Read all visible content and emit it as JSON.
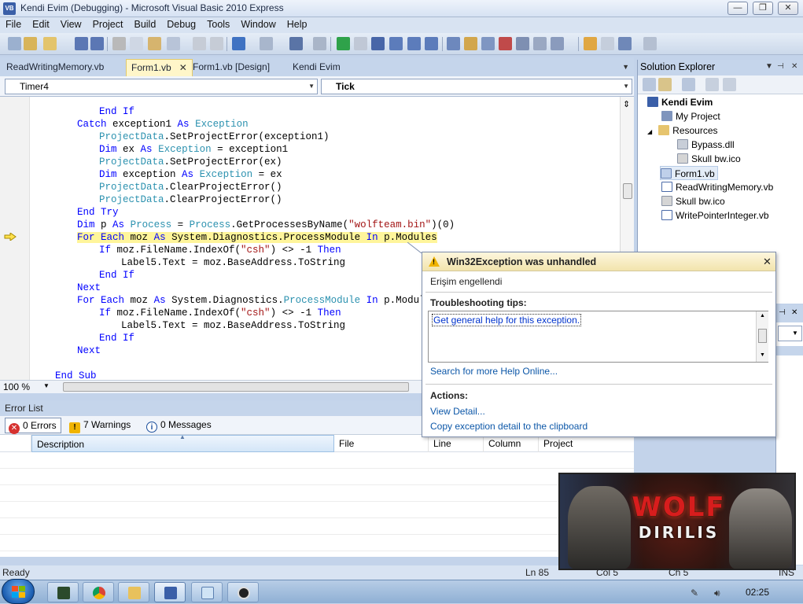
{
  "window": {
    "title": "Kendi Evim (Debugging) - Microsoft Visual Basic 2010 Express",
    "app_icon": "VB",
    "minimize": "—",
    "restore": "❐",
    "close": "✕"
  },
  "menu": [
    "File",
    "Edit",
    "View",
    "Project",
    "Build",
    "Debug",
    "Tools",
    "Window",
    "Help"
  ],
  "tabs": {
    "items": [
      {
        "label": "ReadWritingMemory.vb",
        "active": false
      },
      {
        "label": "Form1.vb",
        "active": true,
        "close": "✕"
      },
      {
        "label": "Form1.vb [Design]",
        "active": false
      },
      {
        "label": "Kendi Evim",
        "active": false
      }
    ],
    "overflow": "▼"
  },
  "combos": {
    "object": "Timer4",
    "event": "Tick"
  },
  "code_lines": [
    {
      "indent": 12,
      "tokens": [
        {
          "t": "End If",
          "c": "kw"
        }
      ]
    },
    {
      "indent": 8,
      "tokens": [
        {
          "t": "Catch",
          "c": "kw"
        },
        {
          "t": " exception1 "
        },
        {
          "t": "As",
          "c": "kw"
        },
        {
          "t": " "
        },
        {
          "t": "Exception",
          "c": "ty"
        }
      ]
    },
    {
      "indent": 12,
      "tokens": [
        {
          "t": "ProjectData",
          "c": "ty"
        },
        {
          "t": ".SetProjectError(exception1)"
        }
      ]
    },
    {
      "indent": 12,
      "tokens": [
        {
          "t": "Dim",
          "c": "kw"
        },
        {
          "t": " ex "
        },
        {
          "t": "As",
          "c": "kw"
        },
        {
          "t": " "
        },
        {
          "t": "Exception",
          "c": "ty"
        },
        {
          "t": " = exception1"
        }
      ]
    },
    {
      "indent": 12,
      "tokens": [
        {
          "t": "ProjectData",
          "c": "ty"
        },
        {
          "t": ".SetProjectError(ex)"
        }
      ]
    },
    {
      "indent": 12,
      "tokens": [
        {
          "t": "Dim",
          "c": "kw"
        },
        {
          "t": " exception "
        },
        {
          "t": "As",
          "c": "kw"
        },
        {
          "t": " "
        },
        {
          "t": "Exception",
          "c": "ty"
        },
        {
          "t": " = ex"
        }
      ]
    },
    {
      "indent": 12,
      "tokens": [
        {
          "t": "ProjectData",
          "c": "ty"
        },
        {
          "t": ".ClearProjectError()"
        }
      ]
    },
    {
      "indent": 12,
      "tokens": [
        {
          "t": "ProjectData",
          "c": "ty"
        },
        {
          "t": ".ClearProjectError()"
        }
      ]
    },
    {
      "indent": 8,
      "tokens": [
        {
          "t": "End Try",
          "c": "kw"
        }
      ]
    },
    {
      "indent": 8,
      "tokens": [
        {
          "t": "Dim",
          "c": "kw"
        },
        {
          "t": " p "
        },
        {
          "t": "As",
          "c": "kw"
        },
        {
          "t": " "
        },
        {
          "t": "Process",
          "c": "ty"
        },
        {
          "t": " = "
        },
        {
          "t": "Process",
          "c": "ty"
        },
        {
          "t": ".GetProcessesByName("
        },
        {
          "t": "\"wolfteam.bin\"",
          "c": "st"
        },
        {
          "t": ")(0)"
        }
      ]
    },
    {
      "indent": 8,
      "highlight": true,
      "tokens": [
        {
          "t": "For",
          "c": "kw"
        },
        {
          "t": " "
        },
        {
          "t": "Each",
          "c": "kw"
        },
        {
          "t": " moz "
        },
        {
          "t": "As",
          "c": "kw"
        },
        {
          "t": " System.Diagnostics.ProcessModule "
        },
        {
          "t": "In",
          "c": "kw"
        },
        {
          "t": " p.Modules"
        }
      ]
    },
    {
      "indent": 12,
      "tokens": [
        {
          "t": "If",
          "c": "kw"
        },
        {
          "t": " moz.FileName.IndexOf("
        },
        {
          "t": "\"csh\"",
          "c": "st"
        },
        {
          "t": ") <> -1 "
        },
        {
          "t": "Then",
          "c": "kw"
        }
      ]
    },
    {
      "indent": 16,
      "tokens": [
        {
          "t": "Label5.Text = moz.BaseAddress.ToString"
        }
      ]
    },
    {
      "indent": 12,
      "tokens": [
        {
          "t": "End If",
          "c": "kw"
        }
      ]
    },
    {
      "indent": 8,
      "tokens": [
        {
          "t": "Next",
          "c": "kw"
        }
      ]
    },
    {
      "indent": 8,
      "tokens": [
        {
          "t": "For",
          "c": "kw"
        },
        {
          "t": " "
        },
        {
          "t": "Each",
          "c": "kw"
        },
        {
          "t": " moz "
        },
        {
          "t": "As",
          "c": "kw"
        },
        {
          "t": " System.Diagnostics."
        },
        {
          "t": "ProcessModule",
          "c": "ty"
        },
        {
          "t": " "
        },
        {
          "t": "In",
          "c": "kw"
        },
        {
          "t": " p.Modules"
        }
      ]
    },
    {
      "indent": 12,
      "tokens": [
        {
          "t": "If",
          "c": "kw"
        },
        {
          "t": " moz.FileName.IndexOf("
        },
        {
          "t": "\"csh\"",
          "c": "st"
        },
        {
          "t": ") <> -1 "
        },
        {
          "t": "Then",
          "c": "kw"
        }
      ]
    },
    {
      "indent": 16,
      "tokens": [
        {
          "t": "Label5.Text = moz.BaseAddress.ToString"
        }
      ]
    },
    {
      "indent": 12,
      "tokens": [
        {
          "t": "End If",
          "c": "kw"
        }
      ]
    },
    {
      "indent": 8,
      "tokens": [
        {
          "t": "Next",
          "c": "kw"
        }
      ]
    },
    {
      "indent": 0,
      "tokens": [
        {
          "t": ""
        }
      ]
    },
    {
      "indent": 4,
      "tokens": [
        {
          "t": "End Sub",
          "c": "kw"
        }
      ]
    }
  ],
  "zoom": "100 %",
  "error_list": {
    "title": "Error List",
    "filters": {
      "errors": "0 Errors",
      "warnings": "7 Warnings",
      "messages": "0 Messages"
    },
    "columns": [
      "Description",
      "File",
      "Line",
      "Column",
      "Project"
    ],
    "sort_indicator": "▲"
  },
  "exception": {
    "title": "Win32Exception was unhandled",
    "close": "✕",
    "message": "Erişim engellendi",
    "tips_header": "Troubleshooting tips:",
    "tip_link": "Get general help for this exception.",
    "search_link": "Search for more Help Online...",
    "actions_header": "Actions:",
    "view_detail": "View Detail...",
    "copy_detail": "Copy exception detail to the clipboard"
  },
  "solution_explorer": {
    "title": "Solution Explorer",
    "project": "Kendi Evim",
    "items": [
      {
        "label": "My Project",
        "level": 1,
        "icon": "wrench-icon"
      },
      {
        "label": "Resources",
        "level": 1,
        "icon": "folder-icon",
        "expander": "◢"
      },
      {
        "label": "Bypass.dll",
        "level": 2,
        "icon": "file-icon"
      },
      {
        "label": "Skull bw.ico",
        "level": 2,
        "icon": "image-icon"
      },
      {
        "label": "Form1.vb",
        "level": 1,
        "icon": "form-icon",
        "selected": true
      },
      {
        "label": "ReadWritingMemory.vb",
        "level": 1,
        "icon": "vb-file-icon"
      },
      {
        "label": "Skull bw.ico",
        "level": 1,
        "icon": "image-icon"
      },
      {
        "label": "WritePointerInteger.vb",
        "level": 1,
        "icon": "vb-file-icon"
      }
    ]
  },
  "status": {
    "state": "Ready",
    "line": "Ln 85",
    "col": "Col 5",
    "ch": "Ch 5",
    "ins": "INS"
  },
  "banner": {
    "title": "WOLF",
    "subtitle": "DIRILIS"
  },
  "taskbar": {
    "clock": "02:25"
  },
  "colors": {
    "keyword": "#0000ff",
    "type": "#2b91af",
    "string": "#a31515",
    "current_line": "#fff59b",
    "link": "#0c57a8"
  }
}
